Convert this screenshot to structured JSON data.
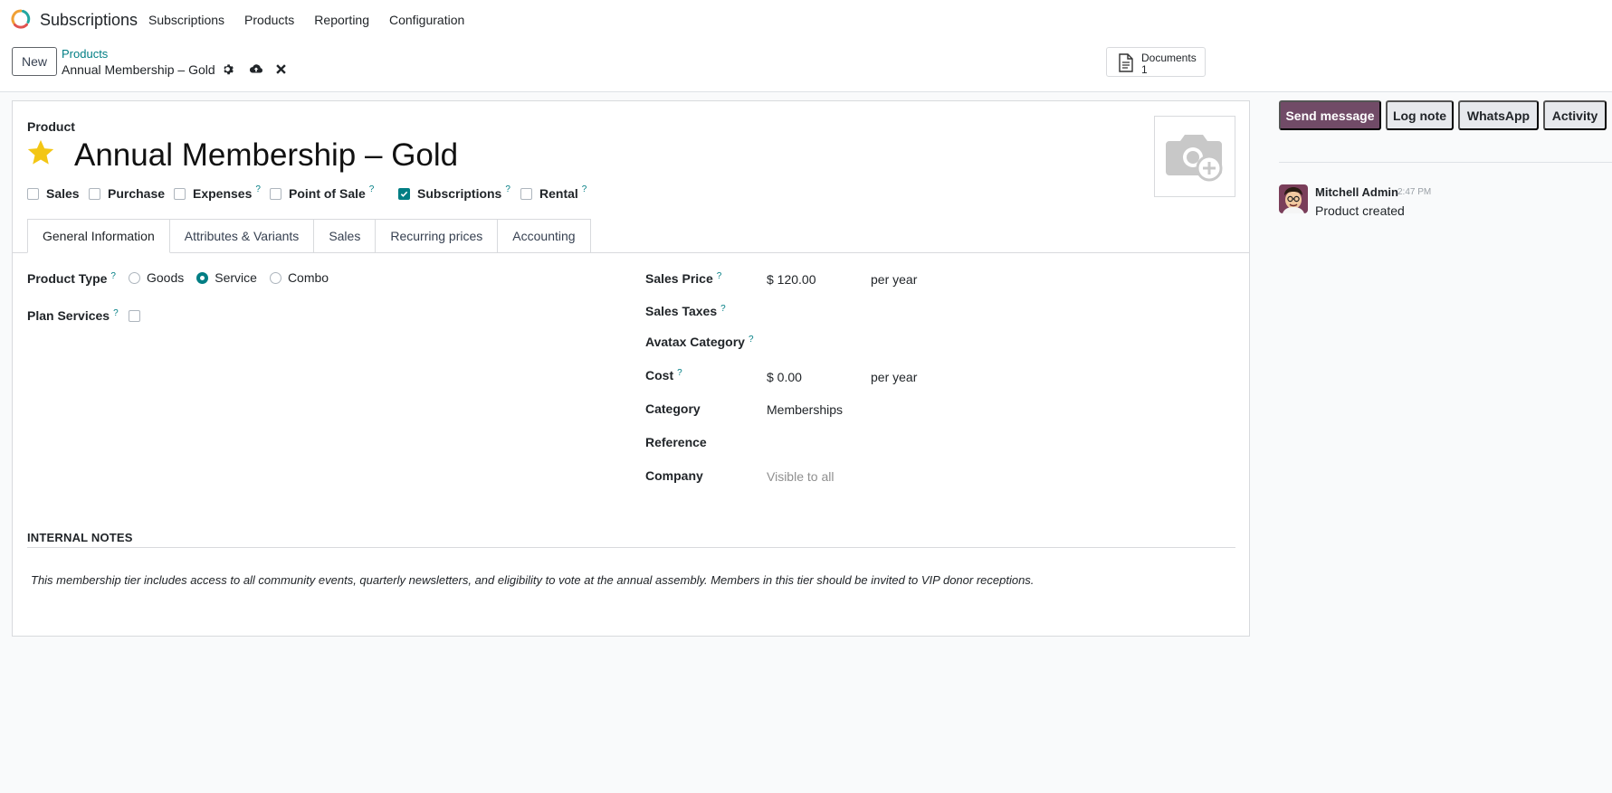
{
  "app": {
    "name": "Subscriptions",
    "menu": [
      "Subscriptions",
      "Products",
      "Reporting",
      "Configuration"
    ]
  },
  "control_panel": {
    "new_label": "New",
    "breadcrumb_parent": "Products",
    "breadcrumb_current": "Annual Membership – Gold",
    "documents_label": "Documents",
    "documents_count": "1"
  },
  "form": {
    "record_type_label": "Product",
    "title": "Annual Membership – Gold",
    "favorite": true,
    "flags": [
      {
        "label": "Sales",
        "checked": false,
        "help": false
      },
      {
        "label": "Purchase",
        "checked": false,
        "help": false
      },
      {
        "label": "Expenses",
        "checked": false,
        "help": true
      },
      {
        "label": "Point of Sale",
        "checked": false,
        "help": true
      },
      {
        "label": "Subscriptions",
        "checked": true,
        "help": true
      },
      {
        "label": "Rental",
        "checked": false,
        "help": true
      }
    ],
    "help_mark": "?",
    "tabs": [
      "General Information",
      "Attributes & Variants",
      "Sales",
      "Recurring prices",
      "Accounting"
    ],
    "active_tab": "General Information",
    "left": {
      "product_type_label": "Product Type",
      "product_type_options": [
        "Goods",
        "Service",
        "Combo"
      ],
      "product_type_selected": "Service",
      "plan_services_label": "Plan Services",
      "plan_services_checked": false
    },
    "right": {
      "sales_price_label": "Sales Price",
      "sales_price_value": "$ 120.00",
      "sales_price_unit": "per year",
      "sales_taxes_label": "Sales Taxes",
      "avatax_category_label": "Avatax Category",
      "cost_label": "Cost",
      "cost_value": "$ 0.00",
      "cost_unit": "per year",
      "category_label": "Category",
      "category_value": "Memberships",
      "reference_label": "Reference",
      "company_label": "Company",
      "company_placeholder": "Visible to all"
    },
    "internal_notes_heading": "INTERNAL NOTES",
    "internal_notes_text": "This membership tier includes access to all community events, quarterly newsletters, and eligibility to vote at the annual assembly. Members in this tier should be invited to VIP donor receptions."
  },
  "chatter": {
    "send_message": "Send message",
    "log_note": "Log note",
    "whatsapp": "WhatsApp",
    "activity": "Activity",
    "message": {
      "author": "Mitchell Admin",
      "time": "2:47 PM",
      "body": "Product created"
    }
  },
  "colors": {
    "brand": "#714b67",
    "accent": "#017e84",
    "star": "#f3c614"
  }
}
